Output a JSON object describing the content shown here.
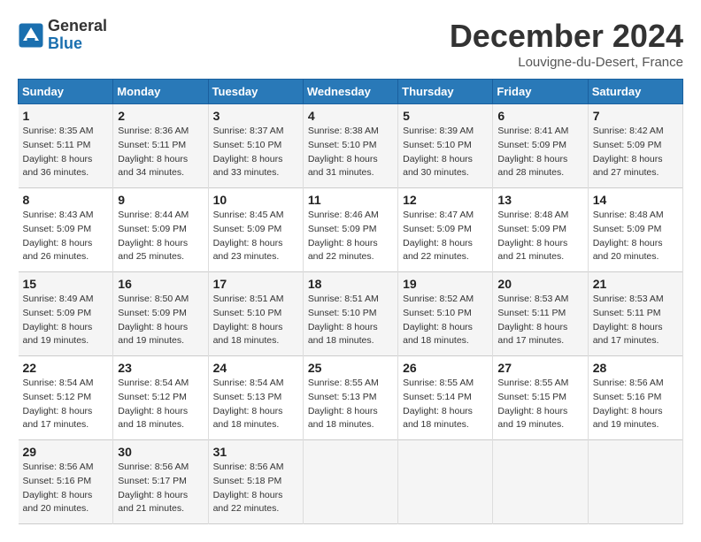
{
  "logo": {
    "line1": "General",
    "line2": "Blue"
  },
  "title": "December 2024",
  "subtitle": "Louvigne-du-Desert, France",
  "days_header": [
    "Sunday",
    "Monday",
    "Tuesday",
    "Wednesday",
    "Thursday",
    "Friday",
    "Saturday"
  ],
  "weeks": [
    [
      {
        "day": "1",
        "sunrise": "Sunrise: 8:35 AM",
        "sunset": "Sunset: 5:11 PM",
        "daylight": "Daylight: 8 hours and 36 minutes."
      },
      {
        "day": "2",
        "sunrise": "Sunrise: 8:36 AM",
        "sunset": "Sunset: 5:11 PM",
        "daylight": "Daylight: 8 hours and 34 minutes."
      },
      {
        "day": "3",
        "sunrise": "Sunrise: 8:37 AM",
        "sunset": "Sunset: 5:10 PM",
        "daylight": "Daylight: 8 hours and 33 minutes."
      },
      {
        "day": "4",
        "sunrise": "Sunrise: 8:38 AM",
        "sunset": "Sunset: 5:10 PM",
        "daylight": "Daylight: 8 hours and 31 minutes."
      },
      {
        "day": "5",
        "sunrise": "Sunrise: 8:39 AM",
        "sunset": "Sunset: 5:10 PM",
        "daylight": "Daylight: 8 hours and 30 minutes."
      },
      {
        "day": "6",
        "sunrise": "Sunrise: 8:41 AM",
        "sunset": "Sunset: 5:09 PM",
        "daylight": "Daylight: 8 hours and 28 minutes."
      },
      {
        "day": "7",
        "sunrise": "Sunrise: 8:42 AM",
        "sunset": "Sunset: 5:09 PM",
        "daylight": "Daylight: 8 hours and 27 minutes."
      }
    ],
    [
      {
        "day": "8",
        "sunrise": "Sunrise: 8:43 AM",
        "sunset": "Sunset: 5:09 PM",
        "daylight": "Daylight: 8 hours and 26 minutes."
      },
      {
        "day": "9",
        "sunrise": "Sunrise: 8:44 AM",
        "sunset": "Sunset: 5:09 PM",
        "daylight": "Daylight: 8 hours and 25 minutes."
      },
      {
        "day": "10",
        "sunrise": "Sunrise: 8:45 AM",
        "sunset": "Sunset: 5:09 PM",
        "daylight": "Daylight: 8 hours and 23 minutes."
      },
      {
        "day": "11",
        "sunrise": "Sunrise: 8:46 AM",
        "sunset": "Sunset: 5:09 PM",
        "daylight": "Daylight: 8 hours and 22 minutes."
      },
      {
        "day": "12",
        "sunrise": "Sunrise: 8:47 AM",
        "sunset": "Sunset: 5:09 PM",
        "daylight": "Daylight: 8 hours and 22 minutes."
      },
      {
        "day": "13",
        "sunrise": "Sunrise: 8:48 AM",
        "sunset": "Sunset: 5:09 PM",
        "daylight": "Daylight: 8 hours and 21 minutes."
      },
      {
        "day": "14",
        "sunrise": "Sunrise: 8:48 AM",
        "sunset": "Sunset: 5:09 PM",
        "daylight": "Daylight: 8 hours and 20 minutes."
      }
    ],
    [
      {
        "day": "15",
        "sunrise": "Sunrise: 8:49 AM",
        "sunset": "Sunset: 5:09 PM",
        "daylight": "Daylight: 8 hours and 19 minutes."
      },
      {
        "day": "16",
        "sunrise": "Sunrise: 8:50 AM",
        "sunset": "Sunset: 5:09 PM",
        "daylight": "Daylight: 8 hours and 19 minutes."
      },
      {
        "day": "17",
        "sunrise": "Sunrise: 8:51 AM",
        "sunset": "Sunset: 5:10 PM",
        "daylight": "Daylight: 8 hours and 18 minutes."
      },
      {
        "day": "18",
        "sunrise": "Sunrise: 8:51 AM",
        "sunset": "Sunset: 5:10 PM",
        "daylight": "Daylight: 8 hours and 18 minutes."
      },
      {
        "day": "19",
        "sunrise": "Sunrise: 8:52 AM",
        "sunset": "Sunset: 5:10 PM",
        "daylight": "Daylight: 8 hours and 18 minutes."
      },
      {
        "day": "20",
        "sunrise": "Sunrise: 8:53 AM",
        "sunset": "Sunset: 5:11 PM",
        "daylight": "Daylight: 8 hours and 17 minutes."
      },
      {
        "day": "21",
        "sunrise": "Sunrise: 8:53 AM",
        "sunset": "Sunset: 5:11 PM",
        "daylight": "Daylight: 8 hours and 17 minutes."
      }
    ],
    [
      {
        "day": "22",
        "sunrise": "Sunrise: 8:54 AM",
        "sunset": "Sunset: 5:12 PM",
        "daylight": "Daylight: 8 hours and 17 minutes."
      },
      {
        "day": "23",
        "sunrise": "Sunrise: 8:54 AM",
        "sunset": "Sunset: 5:12 PM",
        "daylight": "Daylight: 8 hours and 18 minutes."
      },
      {
        "day": "24",
        "sunrise": "Sunrise: 8:54 AM",
        "sunset": "Sunset: 5:13 PM",
        "daylight": "Daylight: 8 hours and 18 minutes."
      },
      {
        "day": "25",
        "sunrise": "Sunrise: 8:55 AM",
        "sunset": "Sunset: 5:13 PM",
        "daylight": "Daylight: 8 hours and 18 minutes."
      },
      {
        "day": "26",
        "sunrise": "Sunrise: 8:55 AM",
        "sunset": "Sunset: 5:14 PM",
        "daylight": "Daylight: 8 hours and 18 minutes."
      },
      {
        "day": "27",
        "sunrise": "Sunrise: 8:55 AM",
        "sunset": "Sunset: 5:15 PM",
        "daylight": "Daylight: 8 hours and 19 minutes."
      },
      {
        "day": "28",
        "sunrise": "Sunrise: 8:56 AM",
        "sunset": "Sunset: 5:16 PM",
        "daylight": "Daylight: 8 hours and 19 minutes."
      }
    ],
    [
      {
        "day": "29",
        "sunrise": "Sunrise: 8:56 AM",
        "sunset": "Sunset: 5:16 PM",
        "daylight": "Daylight: 8 hours and 20 minutes."
      },
      {
        "day": "30",
        "sunrise": "Sunrise: 8:56 AM",
        "sunset": "Sunset: 5:17 PM",
        "daylight": "Daylight: 8 hours and 21 minutes."
      },
      {
        "day": "31",
        "sunrise": "Sunrise: 8:56 AM",
        "sunset": "Sunset: 5:18 PM",
        "daylight": "Daylight: 8 hours and 22 minutes."
      },
      null,
      null,
      null,
      null
    ]
  ]
}
